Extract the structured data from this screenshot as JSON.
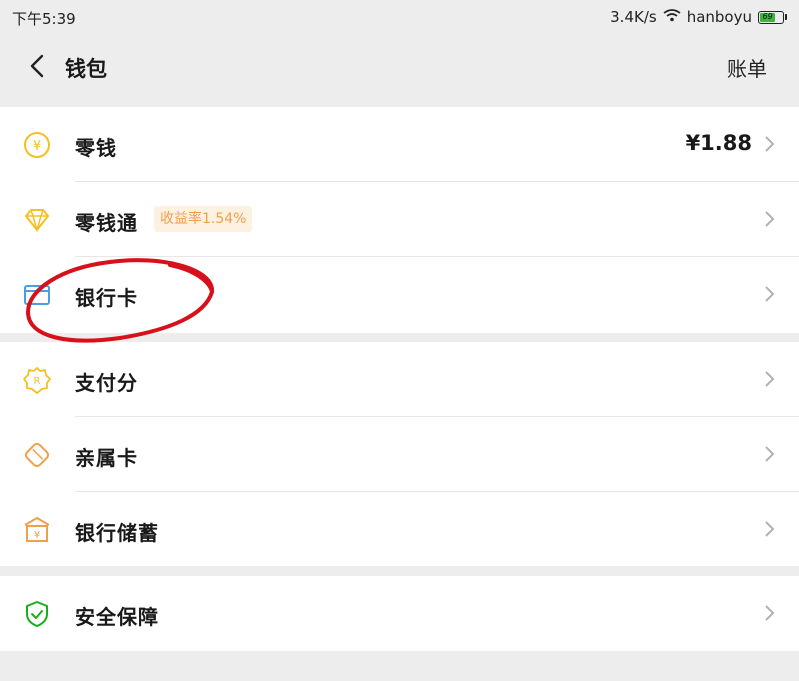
{
  "status": {
    "time": "下午5:39",
    "network_speed": "3.4K/s",
    "wifi_name": "hanboyu",
    "battery_level": "69"
  },
  "nav": {
    "title": "钱包",
    "bill_label": "账单"
  },
  "groups": [
    {
      "items": [
        {
          "label": "零钱",
          "icon": "coin-icon",
          "value": "¥1.88"
        },
        {
          "label": "零钱通",
          "icon": "diamond-icon",
          "badge": "收益率1.54%"
        },
        {
          "label": "银行卡",
          "icon": "card-icon"
        }
      ]
    },
    {
      "items": [
        {
          "label": "支付分",
          "icon": "score-icon"
        },
        {
          "label": "亲属卡",
          "icon": "family-card-icon"
        },
        {
          "label": "银行储蓄",
          "icon": "bank-savings-icon"
        }
      ]
    },
    {
      "items": [
        {
          "label": "安全保障",
          "icon": "shield-icon"
        }
      ]
    }
  ],
  "colors": {
    "yellow_icon": "#f5c020",
    "orange_icon": "#f0a04b",
    "blue_icon": "#4a9ee0",
    "green_icon": "#1aad19",
    "annotation_red": "#d8101a"
  }
}
